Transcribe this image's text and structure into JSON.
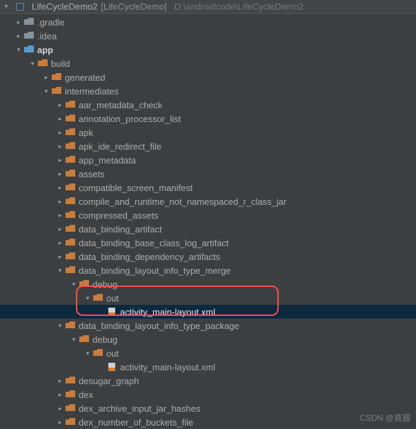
{
  "header": {
    "project": "LifeCycleDemo2",
    "module_bracket": "[LifeCycleDemo]",
    "path": "D:\\androidcode\\LifeCycleDemo2"
  },
  "tree": {
    "gradle": ".gradle",
    "idea": ".idea",
    "app": "app",
    "build": "build",
    "generated": "generated",
    "intermediates": "intermediates",
    "items": {
      "aar_metadata_check": "aar_metadata_check",
      "annotation_processor_list": "annotation_processor_list",
      "apk": "apk",
      "apk_ide_redirect_file": "apk_ide_redirect_file",
      "app_metadata": "app_metadata",
      "assets": "assets",
      "compatible_screen_manifest": "compatible_screen_manifest",
      "compile_and_runtime": "compile_and_runtime_not_namespaced_r_class_jar",
      "compressed_assets": "compressed_assets",
      "data_binding_artifact": "data_binding_artifact",
      "data_binding_base_class_log_artifact": "data_binding_base_class_log_artifact",
      "data_binding_dependency_artifacts": "data_binding_dependency_artifacts",
      "data_binding_layout_info_type_merge": "data_binding_layout_info_type_merge",
      "debug": "debug",
      "out": "out",
      "activity_main_layout_xml": "activity_main-layout.xml",
      "data_binding_layout_info_type_package": "data_binding_layout_info_type_package",
      "desugar_graph": "desugar_graph",
      "dex": "dex",
      "dex_archive_input_jar_hashes": "dex_archive_input_jar_hashes",
      "dex_number_of_buckets_file": "dex_number_of_buckets_file"
    }
  },
  "watermark": "CSDN @袁震"
}
